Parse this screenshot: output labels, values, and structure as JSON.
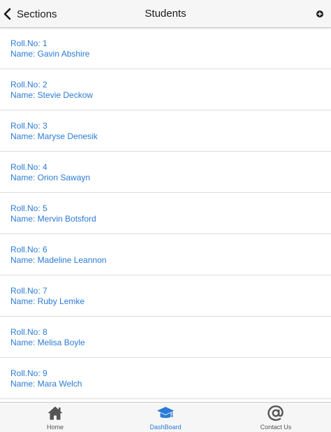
{
  "header": {
    "back_label": "Sections",
    "title": "Students"
  },
  "students": [
    {
      "roll": "Roll.No: 1",
      "name": "Name: Gavin Abshire"
    },
    {
      "roll": "Roll.No: 2",
      "name": "Name: Stevie Deckow"
    },
    {
      "roll": "Roll.No: 3",
      "name": "Name: Maryse Denesik"
    },
    {
      "roll": "Roll.No: 4",
      "name": "Name: Orion Sawayn"
    },
    {
      "roll": "Roll.No: 5",
      "name": "Name: Mervin Botsford"
    },
    {
      "roll": "Roll.No: 6",
      "name": "Name: Madeline Leannon"
    },
    {
      "roll": "Roll.No: 7",
      "name": "Name: Ruby Lemke"
    },
    {
      "roll": "Roll.No: 8",
      "name": "Name: Melisa Boyle"
    },
    {
      "roll": "Roll.No: 9",
      "name": "Name: Mara Welch"
    }
  ],
  "tabs": [
    {
      "label": "Home",
      "icon": "home-icon",
      "active": false
    },
    {
      "label": "DashBoard",
      "icon": "graduation-cap-icon",
      "active": true
    },
    {
      "label": "Contact Us",
      "icon": "at-sign-icon",
      "active": false
    }
  ],
  "colors": {
    "accent": "#2a7bd5",
    "bar_background": "#f6f6f6",
    "icon_inactive": "#555555"
  }
}
